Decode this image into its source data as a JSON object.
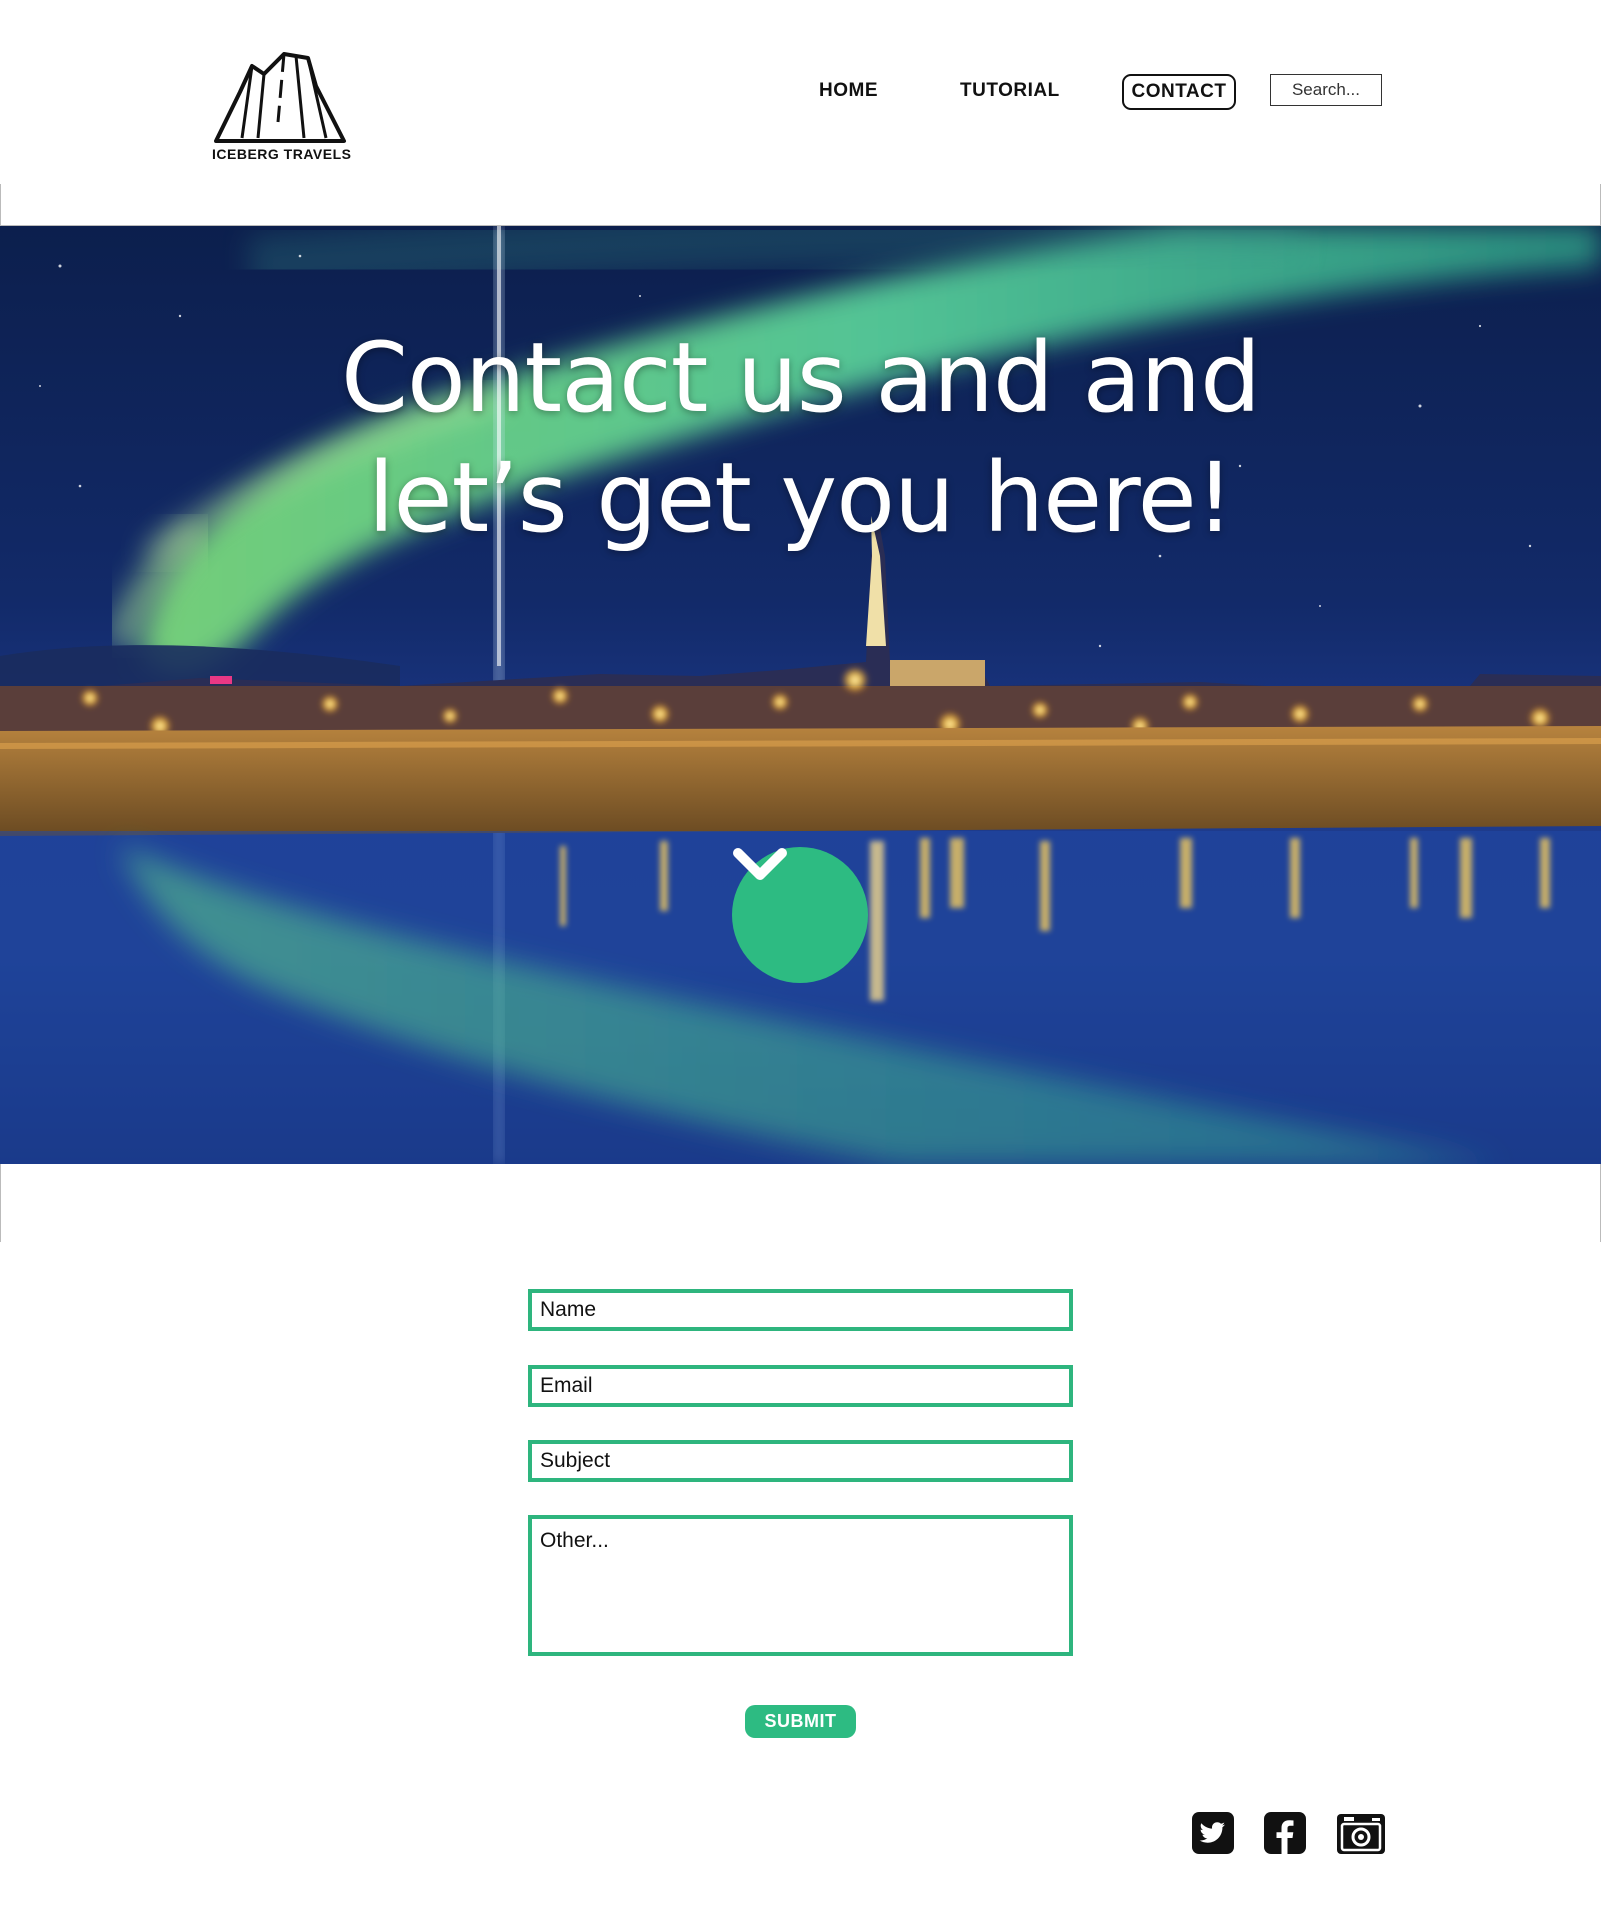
{
  "header": {
    "logo_text": "ICEBERG TRAVELS",
    "nav": {
      "home": "HOME",
      "tutorial": "TUTORIAL",
      "contact": "CONTACT"
    },
    "search": {
      "placeholder": "Search..."
    }
  },
  "hero": {
    "title_line1": "Contact us and and",
    "title_line2": "let’s get you here!",
    "scroll_icon": "chevron-down-icon"
  },
  "form": {
    "name_placeholder": "Name",
    "email_placeholder": "Email",
    "subject_placeholder": "Subject",
    "other_placeholder": "Other...",
    "submit_label": "SUBMIT"
  },
  "social": {
    "icons": [
      "twitter-icon",
      "facebook-icon",
      "camera-icon"
    ]
  },
  "colors": {
    "accent": "#2dbb82",
    "field_border": "#2eb57e",
    "text": "#111111",
    "background": "#ffffff"
  }
}
